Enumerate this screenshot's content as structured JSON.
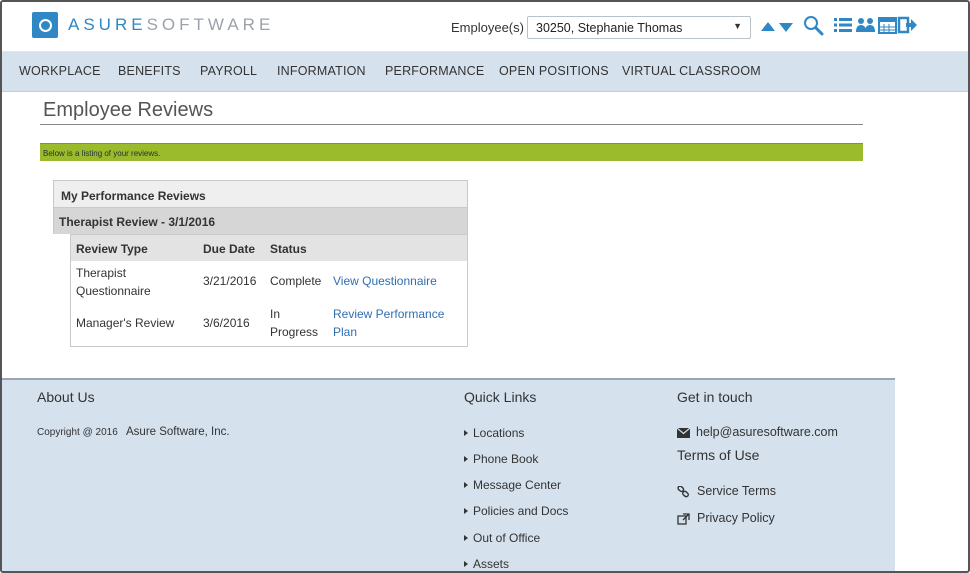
{
  "header": {
    "logo_part1": "ASURE",
    "logo_part2": "SOFTWARE",
    "employee_label": "Employee(s)",
    "employee_selected": "30250, Stephanie Thomas",
    "accent_color": "#2f87c5",
    "icons": [
      "logo-icon",
      "chevron-down-icon",
      "arrow-up-icon",
      "arrow-down-icon",
      "search-icon",
      "list-icon",
      "people-icon",
      "calendar-icon",
      "logout-icon"
    ]
  },
  "nav": {
    "items": [
      "WORKPLACE",
      "BENEFITS",
      "PAYROLL",
      "INFORMATION",
      "PERFORMANCE",
      "OPEN POSITIONS",
      "VIRTUAL CLASSROOM"
    ]
  },
  "main": {
    "title": "Employee Reviews",
    "banner": "Below is a listing of your reviews.",
    "banner_color": "#9cbb2c",
    "reviews": {
      "heading": "My Performance Reviews",
      "group": "Therapist Review - 3/1/2016",
      "columns": [
        "Review Type",
        "Due Date",
        "Status"
      ],
      "rows": [
        {
          "type_line1": "Therapist",
          "type_line2": "Questionnaire",
          "due": "3/21/2016",
          "status_line1": "Complete",
          "status_line2": "",
          "action_line1": "View Questionnaire",
          "action_line2": ""
        },
        {
          "type_line1": "Manager's Review",
          "type_line2": "",
          "due": "3/6/2016",
          "status_line1": "In",
          "status_line2": "Progress",
          "action_line1": "Review Performance",
          "action_line2": "Plan"
        }
      ]
    }
  },
  "footer": {
    "about_heading": "About Us",
    "copyright_prefix": "Copyright @ 2016",
    "copyright_company": "Asure Software, Inc.",
    "quick_links_heading": "Quick Links",
    "quick_links": [
      "Locations",
      "Phone Book",
      "Message Center",
      "Policies and Docs",
      "Out of Office",
      "Assets"
    ],
    "contact_heading": "Get in touch",
    "email": "help@asuresoftware.com",
    "terms_heading": "Terms of Use",
    "service_terms": "Service Terms",
    "privacy_policy": "Privacy Policy"
  }
}
